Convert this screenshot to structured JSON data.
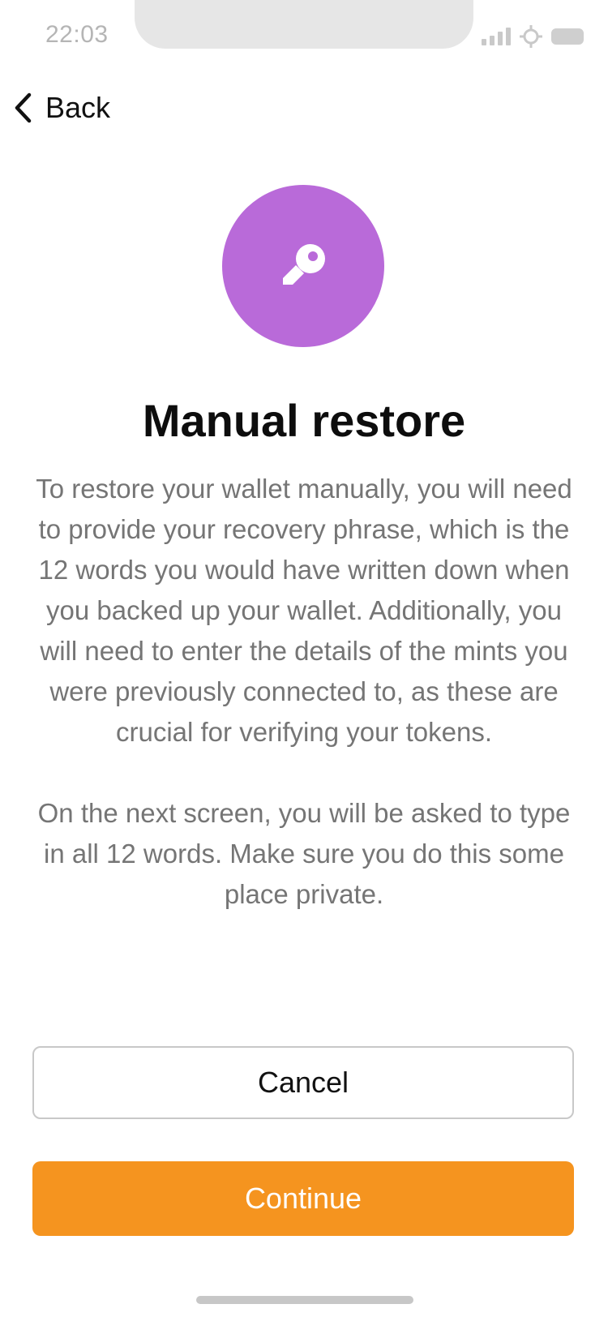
{
  "status_bar": {
    "time": "22:03",
    "icons": [
      "cellular-signal-icon",
      "location-crosshair-icon",
      "battery-icon"
    ]
  },
  "nav": {
    "back_label": "Back",
    "back_icon": "chevron-left-icon"
  },
  "hero": {
    "icon": "key-icon",
    "circle_color": "#b96ad9"
  },
  "content": {
    "title": "Manual restore",
    "paragraph_1": "To restore your wallet manually, you will need to provide your recovery phrase, which is the 12 words you would have written down when you backed up your wallet. Additionally, you will need to enter the details of the mints you were previously connected to, as these are crucial for verifying your tokens.",
    "paragraph_2": "On the next screen, you will be asked to type in all 12 words. Make sure you do this some place private."
  },
  "actions": {
    "cancel_label": "Cancel",
    "continue_label": "Continue",
    "accent_color": "#f5941f"
  }
}
